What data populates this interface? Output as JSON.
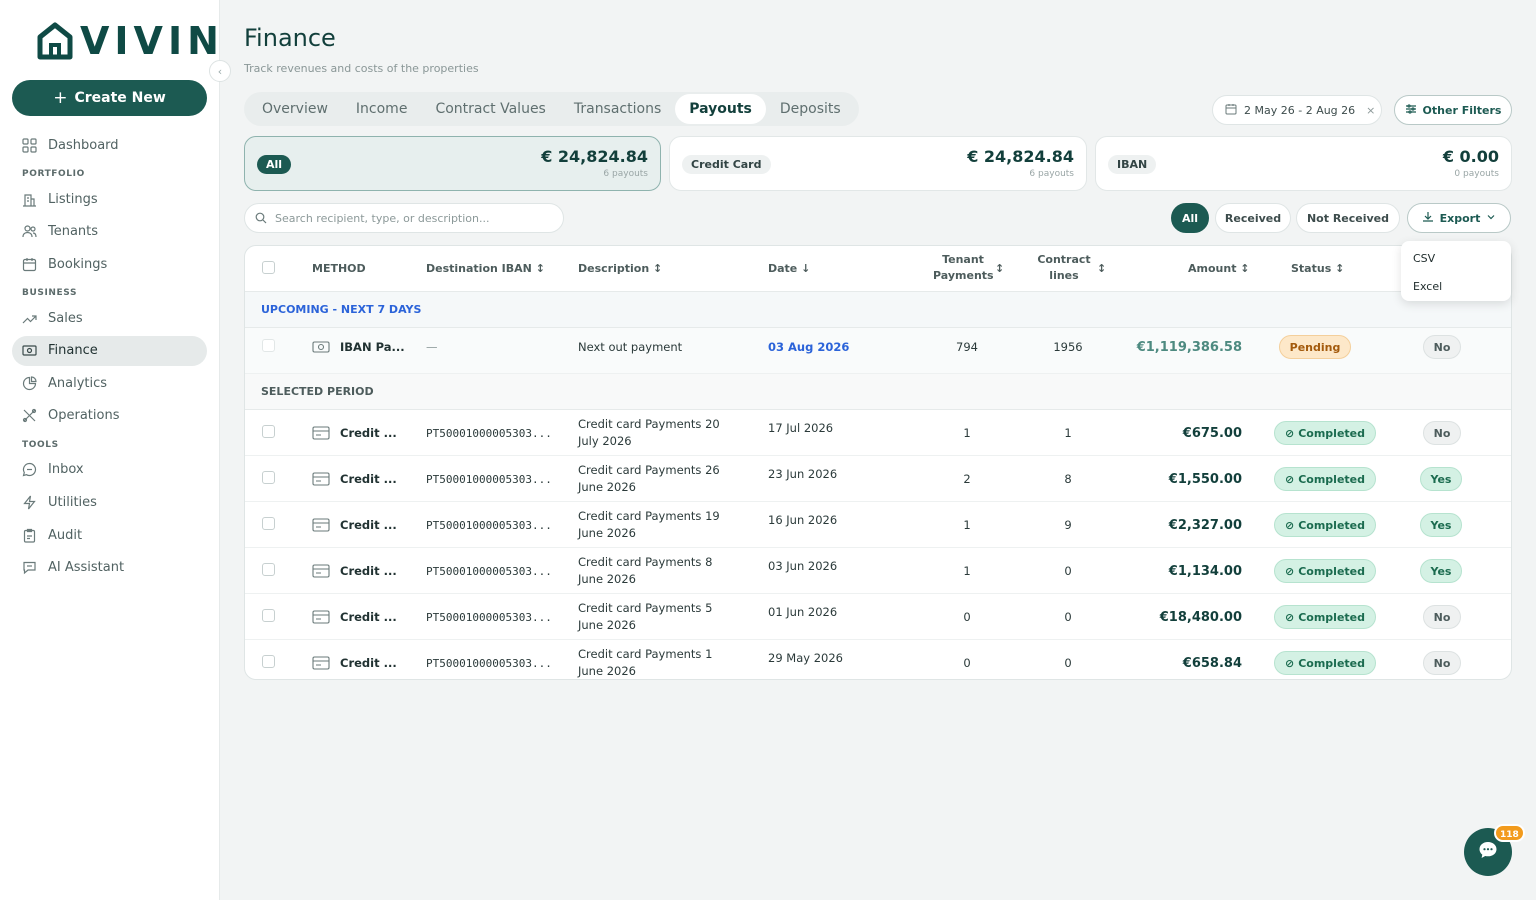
{
  "app": {
    "logo_text": "VIVIN"
  },
  "sidebar": {
    "create_label": "Create New",
    "items": [
      {
        "label": "Dashboard"
      },
      {
        "section": "PORTFOLIO"
      },
      {
        "label": "Listings"
      },
      {
        "label": "Tenants"
      },
      {
        "label": "Bookings"
      },
      {
        "section": "BUSINESS"
      },
      {
        "label": "Sales"
      },
      {
        "label": "Finance"
      },
      {
        "label": "Analytics"
      },
      {
        "label": "Operations"
      },
      {
        "section": "TOOLS"
      },
      {
        "label": "Inbox"
      },
      {
        "label": "Utilities"
      },
      {
        "label": "Audit"
      },
      {
        "label": "AI Assistant"
      }
    ]
  },
  "header": {
    "title": "Finance",
    "subtitle": "Track revenues and costs of the properties"
  },
  "tabs": [
    "Overview",
    "Income",
    "Contract Values",
    "Transactions",
    "Payouts",
    "Deposits"
  ],
  "active_tab": "Payouts",
  "filters": {
    "date_range": "2 May 26 - 2 Aug 26",
    "other_filters": "Other Filters"
  },
  "summary_cards": [
    {
      "label": "All",
      "amount": "€ 24,824.84",
      "count": "6 payouts"
    },
    {
      "label": "Credit Card",
      "amount": "€ 24,824.84",
      "count": "6 payouts"
    },
    {
      "label": "IBAN",
      "amount": "€ 0.00",
      "count": "0 payouts"
    }
  ],
  "search": {
    "placeholder": "Search recipient, type, or description..."
  },
  "status_filters": [
    "All",
    "Received",
    "Not Received"
  ],
  "export": {
    "label": "Export",
    "options": [
      "CSV",
      "Excel"
    ]
  },
  "table": {
    "columns": {
      "method": "METHOD",
      "iban": "Destination IBAN",
      "description": "Description",
      "date": "Date",
      "tenant_payments_1": "Tenant",
      "tenant_payments_2": "Payments",
      "contract_lines_1": "Contract",
      "contract_lines_2": "lines",
      "amount": "Amount",
      "status": "Status"
    },
    "upcoming_label": "UPCOMING - NEXT 7 DAYS",
    "upcoming": {
      "method": "IBAN Pa...",
      "iban": "—",
      "description": "Next out payment",
      "date": "03 Aug 2026",
      "tenant_payments": "794",
      "contract_lines": "1956",
      "amount": "€1,119,386.58",
      "status": "Pending",
      "received": "No"
    },
    "period_label": "SELECTED PERIOD",
    "rows": [
      {
        "method": "Credit ...",
        "iban": "PT50001000005303...",
        "desc1": "Credit card Payments 20",
        "desc2": "July 2026",
        "date": "17 Jul 2026",
        "tenant_payments": "1",
        "contract_lines": "1",
        "amount": "€675.00",
        "status": "Completed",
        "received": "No"
      },
      {
        "method": "Credit ...",
        "iban": "PT50001000005303...",
        "desc1": "Credit card Payments 26",
        "desc2": "June 2026",
        "date": "23 Jun 2026",
        "tenant_payments": "2",
        "contract_lines": "8",
        "amount": "€1,550.00",
        "status": "Completed",
        "received": "Yes"
      },
      {
        "method": "Credit ...",
        "iban": "PT50001000005303...",
        "desc1": "Credit card Payments 19",
        "desc2": "June 2026",
        "date": "16 Jun 2026",
        "tenant_payments": "1",
        "contract_lines": "9",
        "amount": "€2,327.00",
        "status": "Completed",
        "received": "Yes"
      },
      {
        "method": "Credit ...",
        "iban": "PT50001000005303...",
        "desc1": "Credit card Payments 8",
        "desc2": "June 2026",
        "date": "03 Jun 2026",
        "tenant_payments": "1",
        "contract_lines": "0",
        "amount": "€1,134.00",
        "status": "Completed",
        "received": "Yes"
      },
      {
        "method": "Credit ...",
        "iban": "PT50001000005303...",
        "desc1": "Credit card Payments 5",
        "desc2": "June 2026",
        "date": "01 Jun 2026",
        "tenant_payments": "0",
        "contract_lines": "0",
        "amount": "€18,480.00",
        "status": "Completed",
        "received": "No"
      },
      {
        "method": "Credit ...",
        "iban": "PT50001000005303...",
        "desc1": "Credit card Payments 1",
        "desc2": "June 2026",
        "date": "29 May 2026",
        "tenant_payments": "0",
        "contract_lines": "0",
        "amount": "€658.84",
        "status": "Completed",
        "received": "No"
      }
    ]
  },
  "chat": {
    "badge": "118"
  },
  "colors": {
    "brand": "#1c5a52",
    "accent_blue": "#2b63d9",
    "completed_bg": "#d4f1e4",
    "pending_bg": "#fde8c9"
  }
}
